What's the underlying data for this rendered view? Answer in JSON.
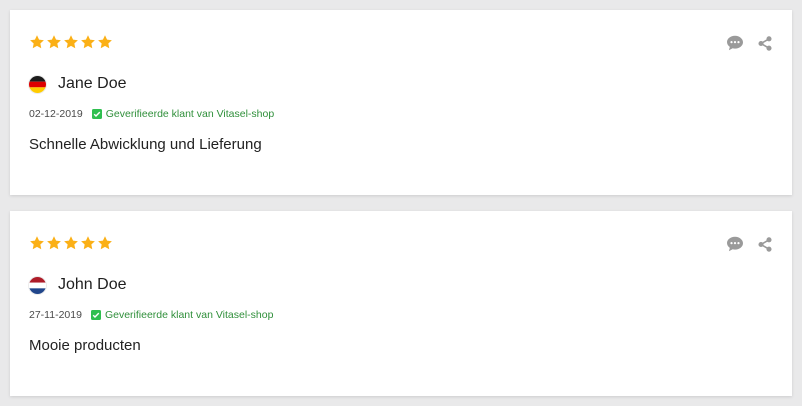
{
  "colors": {
    "star": "#fbb016",
    "icon_gray": "#9a9a9a",
    "verified_green": "#2f8f3a",
    "check_bg": "#2fbf4f"
  },
  "reviews": [
    {
      "rating": 5,
      "author": "Jane Doe",
      "flag": "germany-flag",
      "date": "02-12-2019",
      "verified_text": "Geverifieerde klant van Vitasel-shop",
      "text": "Schnelle Abwicklung und Lieferung"
    },
    {
      "rating": 5,
      "author": "John Doe",
      "flag": "netherlands-flag",
      "date": "27-11-2019",
      "verified_text": "Geverifieerde klant van Vitasel-shop",
      "text": "Mooie producten"
    }
  ]
}
